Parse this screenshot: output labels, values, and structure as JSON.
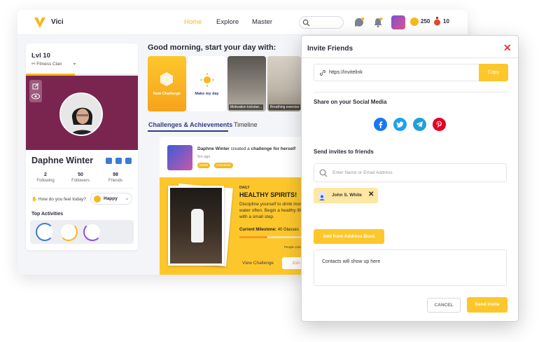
{
  "app": {
    "brand": "Vici",
    "accent": "#f6b81f",
    "icon": "v-logo-icon"
  },
  "nav": {
    "items": [
      "Home",
      "Explore",
      "Master"
    ],
    "active": "Home"
  },
  "header": {
    "coins": "250",
    "potions": "10"
  },
  "profile": {
    "level": "Lvl 10",
    "clan": "Fitness Clan",
    "name": "Daphne Winter",
    "stats": [
      {
        "value": "2",
        "label": "Following"
      },
      {
        "value": "50",
        "label": "Followers"
      },
      {
        "value": "98",
        "label": "Friends"
      }
    ],
    "feel_prompt": "How do you feel today?",
    "mood": "Happy",
    "top_activities_label": "Top Activities"
  },
  "main": {
    "greeting": "Good morning, start your day with:",
    "cards": [
      {
        "label": "New Challenge"
      },
      {
        "label": "Make my day"
      },
      {
        "label": "Motivation kickstar..."
      },
      {
        "label": "Breathing exercise"
      }
    ],
    "tabs": [
      "Challenges & Achievements",
      "Timeline"
    ],
    "feed": {
      "user": "Daphne Winter",
      "action": "created a",
      "bold": "challenge for herself",
      "time": "5m ago",
      "tags": [
        "health",
        "motivation"
      ]
    },
    "challenge": {
      "daily": "DAILY",
      "title": "HEALTHY SPIRITS!",
      "description": "Discipline yourself to drink more water often. Begin a healthy life with a small step.",
      "milestone_label": "Current Milestone:",
      "milestone_value": "40 Glasses",
      "milestone_progress": 0.38,
      "people": "People Joined",
      "view_label": "View Challenge",
      "join_label": "Join"
    }
  },
  "modal": {
    "title": "Invite Friends",
    "link": "https://invitelink",
    "copy_label": "Copy",
    "social_title": "Share on your Social Media",
    "social": [
      {
        "name": "facebook-icon",
        "color": "#1877f2"
      },
      {
        "name": "twitter-icon",
        "color": "#1da1f2"
      },
      {
        "name": "telegram-icon",
        "color": "#229ed9"
      },
      {
        "name": "pinterest-icon",
        "color": "#e60023"
      }
    ],
    "invite_title": "Send invites to friends",
    "input_placeholder": "Enter Name or Email Address",
    "chip": "John S. White",
    "address_book_label": "Add from Address Book",
    "contacts_placeholder": "Contacts will show up here",
    "cancel_label": "CANCEL",
    "send_label": "Send Invite"
  }
}
